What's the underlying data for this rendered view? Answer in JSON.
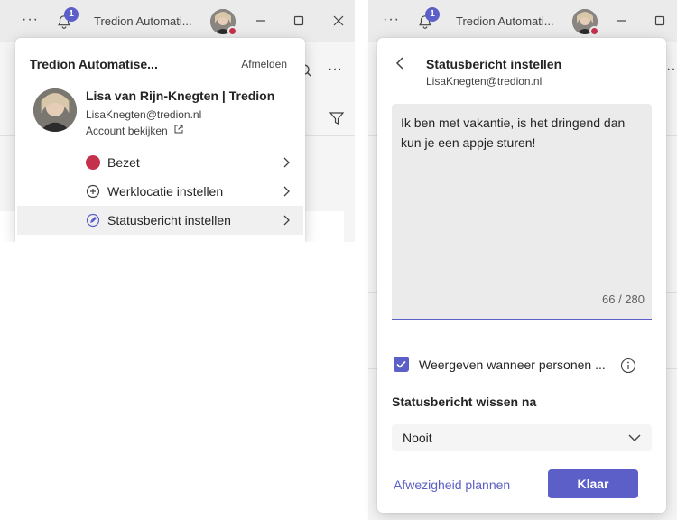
{
  "window": {
    "more_glyph": "···",
    "notification_count": "1",
    "title": "Tredion Automati..."
  },
  "account_menu": {
    "org_name": "Tredion Automatise...",
    "sign_out": "Afmelden",
    "user_name": "Lisa van Rijn-Knegten | Tredion",
    "email": "LisaKnegten@tredion.nl",
    "view_account": "Account bekijken",
    "items": [
      {
        "label": "Bezet",
        "icon": "busy-status-dot",
        "color": "#c4314b"
      },
      {
        "label": "Werklocatie instellen",
        "icon": "add-location-icon"
      },
      {
        "label": "Statusbericht instellen",
        "icon": "edit-status-icon"
      }
    ]
  },
  "status_message": {
    "title": "Statusbericht instellen",
    "email": "LisaKnegten@tredion.nl",
    "message": "Ik ben met vakantie, is het dringend dan kun je een appje sturen!",
    "char_count": "66 / 280",
    "show_when_label": "Weergeven wanneer personen ...",
    "show_when_checked": true,
    "clear_after_label": "Statusbericht wissen na",
    "clear_after_value": "Nooit",
    "schedule_link": "Afwezigheid plannen",
    "done_button": "Klaar"
  },
  "colors": {
    "accent": "#5b5fc7",
    "busy": "#c4314b"
  }
}
